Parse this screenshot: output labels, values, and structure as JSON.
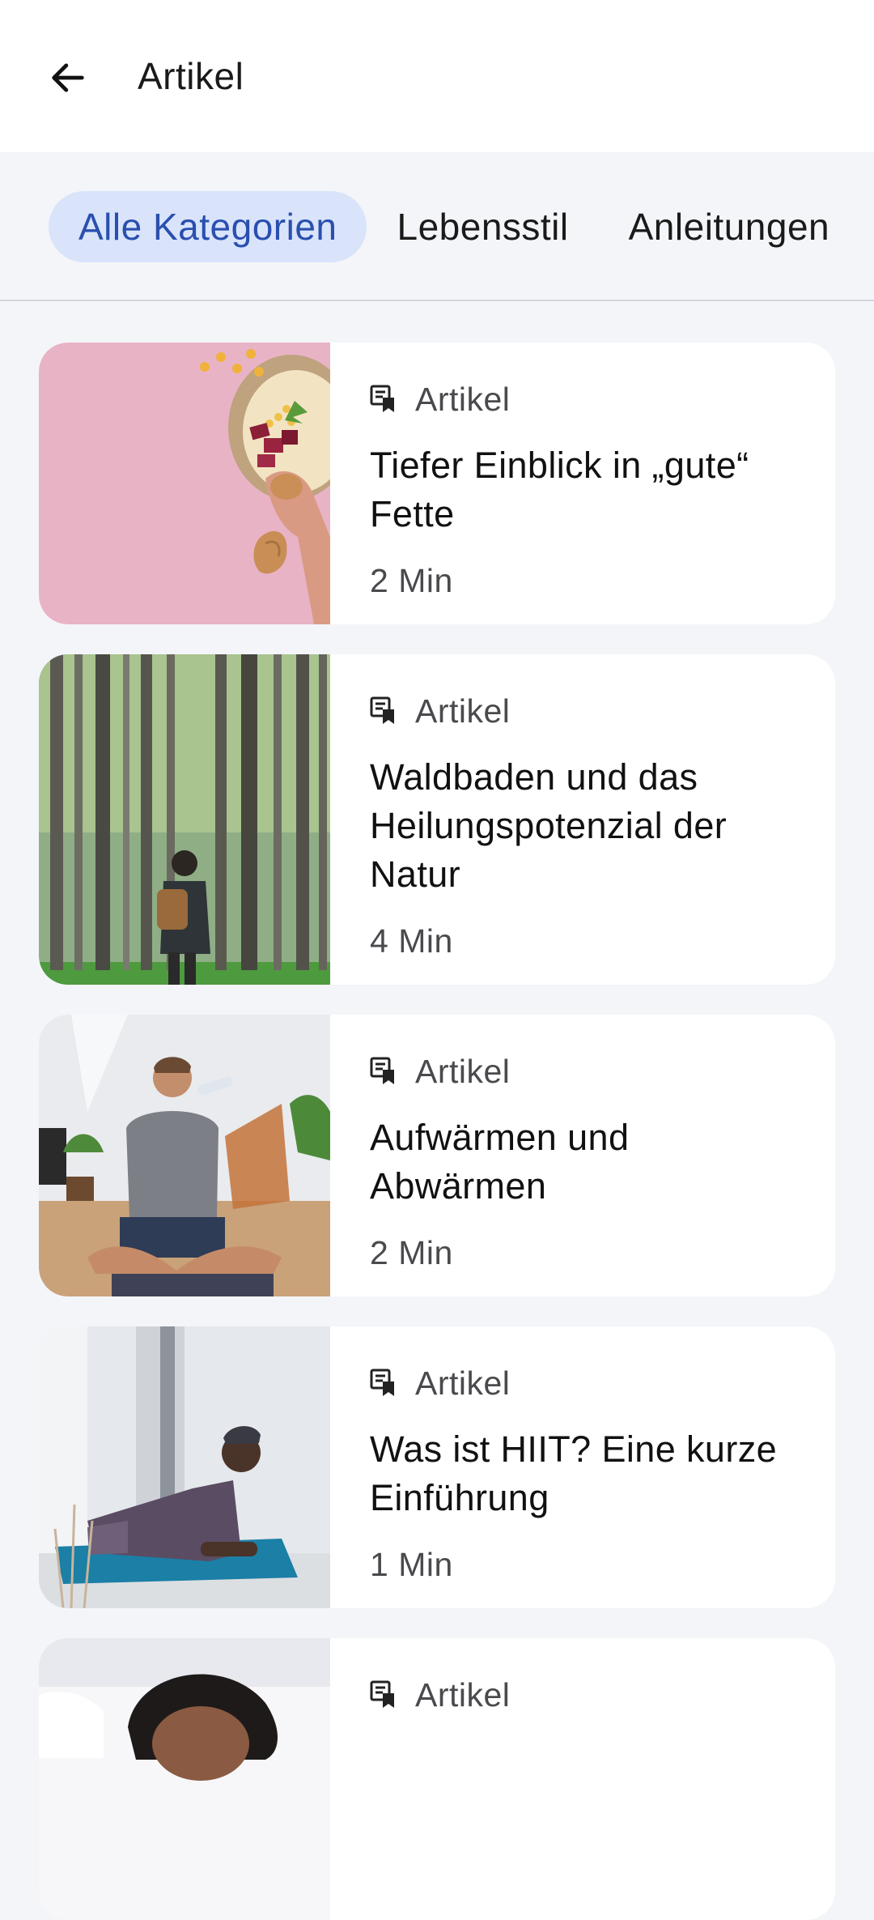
{
  "appbar": {
    "title": "Artikel",
    "back_icon": "arrow-left-icon"
  },
  "categories": [
    {
      "label": "Alle Kategorien",
      "selected": true
    },
    {
      "label": "Lebensstil",
      "selected": false
    },
    {
      "label": "Anleitungen",
      "selected": false
    }
  ],
  "articles": [
    {
      "type_label": "Artikel",
      "title": "Tiefer Einblick in „gute“ Fette",
      "duration": "2 Min"
    },
    {
      "type_label": "Artikel",
      "title": "Waldbaden und das Heilungspotenzial der Natur",
      "duration": "4 Min"
    },
    {
      "type_label": "Artikel",
      "title": "Aufwärmen und Abwärmen",
      "duration": "2 Min"
    },
    {
      "type_label": "Artikel",
      "title": "Was ist HIIT? Eine kurze Einführung",
      "duration": "1 Min"
    },
    {
      "type_label": "Artikel",
      "title": "",
      "duration": ""
    }
  ],
  "colors": {
    "accent_chip_bg": "#d9e4fb",
    "accent_chip_text": "#2a4fae",
    "page_bg": "#f4f5f9"
  }
}
